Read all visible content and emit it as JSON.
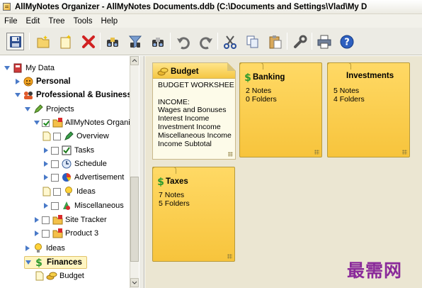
{
  "window": {
    "title": "AllMyNotes Organizer - AllMyNotes Documents.ddb (C:\\Documents and Settings\\Vlad\\My D"
  },
  "menu": [
    "File",
    "Edit",
    "Tree",
    "Tools",
    "Help"
  ],
  "toolbar": {
    "buttons": [
      {
        "name": "save-button",
        "icon": "floppy-disk-icon"
      },
      {
        "name": "new-folder-button",
        "icon": "new-folder-icon"
      },
      {
        "name": "new-note-button",
        "icon": "new-note-icon"
      },
      {
        "name": "delete-button",
        "icon": "red-x-icon"
      },
      {
        "name": "find-button",
        "icon": "binoculars-icon"
      },
      {
        "name": "find-filter-button",
        "icon": "binoculars-funnel-icon"
      },
      {
        "name": "find-next-button",
        "icon": "binoculars-icon"
      },
      {
        "name": "undo-button",
        "icon": "undo-icon"
      },
      {
        "name": "redo-button",
        "icon": "redo-icon"
      },
      {
        "name": "cut-button",
        "icon": "scissors-icon"
      },
      {
        "name": "copy-button",
        "icon": "copy-icon"
      },
      {
        "name": "paste-button",
        "icon": "paste-icon"
      },
      {
        "name": "settings-button",
        "icon": "wrench-icon"
      },
      {
        "name": "print-button",
        "icon": "printer-icon"
      },
      {
        "name": "help-button",
        "icon": "help-icon"
      }
    ]
  },
  "tree": {
    "items": [
      {
        "label": "My Data",
        "icon": "notebook-icon",
        "bold": false,
        "expanded": true
      },
      {
        "label": "Personal",
        "icon": "smiley-icon",
        "bold": true,
        "expanded": false
      },
      {
        "label": "Professional & Business",
        "icon": "group-icon",
        "bold": true,
        "expanded": true
      },
      {
        "label": "Projects",
        "icon": "pencil-icon",
        "bold": false,
        "expanded": true
      },
      {
        "label": "AllMyNotes Organiz",
        "icon": "folder-star-icon",
        "checked": true,
        "expanded": true
      },
      {
        "label": "Overview",
        "icon": "pencil-icon",
        "checked": false
      },
      {
        "label": "Tasks",
        "icon": "checklist-icon",
        "checked": false
      },
      {
        "label": "Schedule",
        "icon": "clock-icon",
        "checked": false
      },
      {
        "label": "Advertisement",
        "icon": "pie-chart-icon",
        "checked": false
      },
      {
        "label": "Ideas",
        "icon": "lightbulb-icon",
        "checked": false
      },
      {
        "label": "Miscellaneous",
        "icon": "shapes-icon",
        "checked": false
      },
      {
        "label": "Site Tracker",
        "icon": "folder-star-icon",
        "checked": false
      },
      {
        "label": "Product 3",
        "icon": "folder-star-icon",
        "checked": false
      },
      {
        "label": "Ideas",
        "icon": "lightbulb-icon",
        "bold": false
      },
      {
        "label": "Finances",
        "icon": "dollar-icon",
        "bold": true,
        "selected": true
      },
      {
        "label": "Budget",
        "icon": "coins-icon",
        "bold": false
      }
    ]
  },
  "notes": [
    {
      "title": "Budget",
      "icon": "coins-icon",
      "type": "note",
      "lines": [
        "BUDGET WORKSHEE",
        "",
        "INCOME:",
        "Wages and Bonuses",
        "Interest Income",
        "Investment Income",
        "Miscellaneous Income",
        "Income Subtotal"
      ]
    },
    {
      "title": "Banking",
      "icon": "dollar-icon",
      "type": "folder",
      "lines": [
        "2 Notes",
        "0 Folders"
      ]
    },
    {
      "title": "Investments",
      "icon": "",
      "type": "folder",
      "lines": [
        "5 Notes",
        "4 Folders"
      ]
    },
    {
      "title": "Taxes",
      "icon": "dollar-icon",
      "type": "folder",
      "lines": [
        "7 Notes",
        "5 Folders"
      ]
    }
  ],
  "watermark": "最需网",
  "colors": {
    "note_yellow": "#f7c43c",
    "note_border": "#b89a3a",
    "selection": "#fff5c2",
    "pane_bg": "#ebe6d2",
    "dollar_green": "#2c9a2c"
  }
}
